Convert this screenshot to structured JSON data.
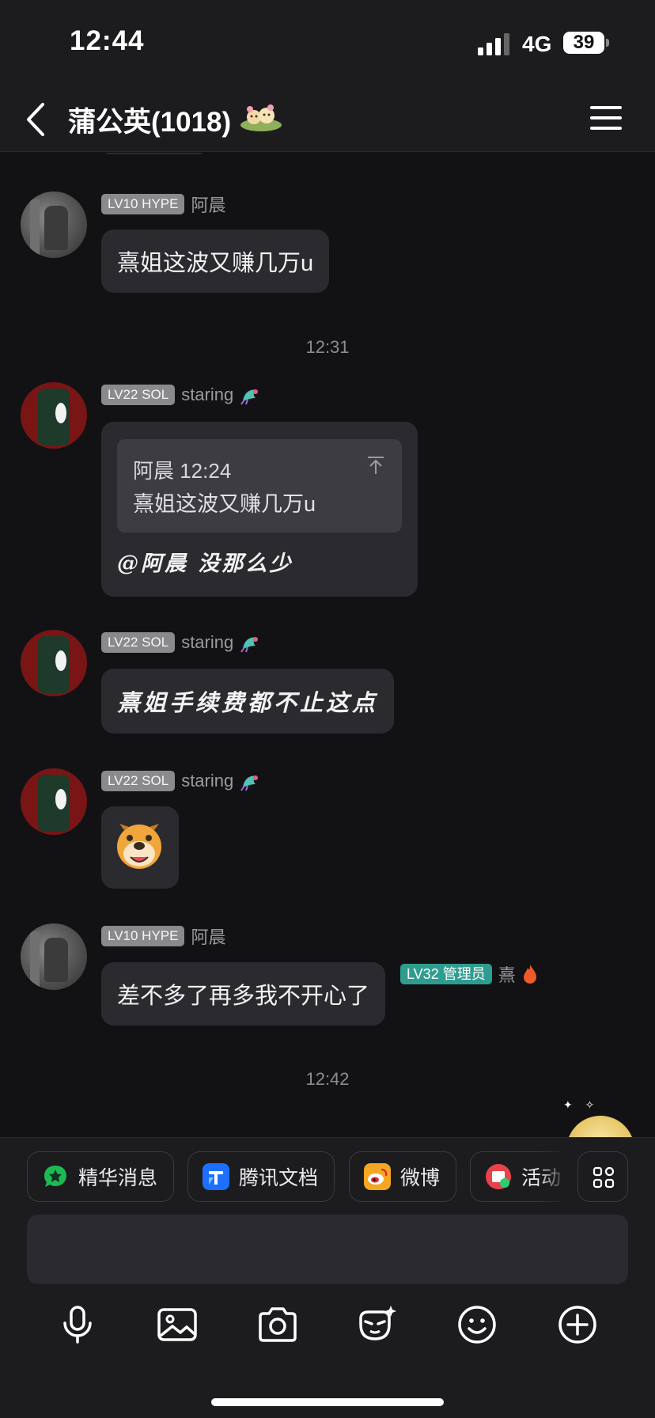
{
  "status": {
    "time": "12:44",
    "network": "4G",
    "battery": "39"
  },
  "header": {
    "title": "蒲公英(1018)"
  },
  "messages": [
    {
      "badge": "LV10 HYPE",
      "sender": "阿晨",
      "text": "熹姐这波又赚几万u"
    },
    {
      "time": "12:31"
    },
    {
      "badge": "LV22 SOL",
      "sender": "staring",
      "quote_meta": "阿晨 12:24",
      "quote_text": "熹姐这波又赚几万u",
      "text": "@阿晨 没那么少"
    },
    {
      "badge": "LV22 SOL",
      "sender": "staring",
      "text": "熹姐手续费都不止这点"
    },
    {
      "badge": "LV22 SOL",
      "sender": "staring",
      "sticker": "dog-face-sticker"
    },
    {
      "badge": "LV10 HYPE",
      "sender": "阿晨",
      "text": "差不多了再多我不开心了"
    },
    {
      "time": "12:42"
    },
    {
      "badge": "LV32 管理员",
      "sender": "熹"
    }
  ],
  "quick_actions": [
    {
      "label": "精华消息",
      "icon": "star-chat-icon",
      "color": "#1db954"
    },
    {
      "label": "腾讯文档",
      "icon": "tencent-docs-icon",
      "color": "#1e6fff"
    },
    {
      "label": "微博",
      "icon": "weibo-icon",
      "color": "#f5a623"
    },
    {
      "label": "活动",
      "icon": "activity-icon",
      "color": "#e8434a"
    }
  ],
  "input": {
    "value": ""
  },
  "tools": [
    "microphone-icon",
    "image-icon",
    "camera-icon",
    "face-effect-icon",
    "emoji-icon",
    "plus-icon"
  ],
  "colors": {
    "background": "#121215",
    "bubble": "#2b2b2f",
    "admin_badge": "#2e9d8f",
    "lv_badge": "#8a8a8e"
  }
}
